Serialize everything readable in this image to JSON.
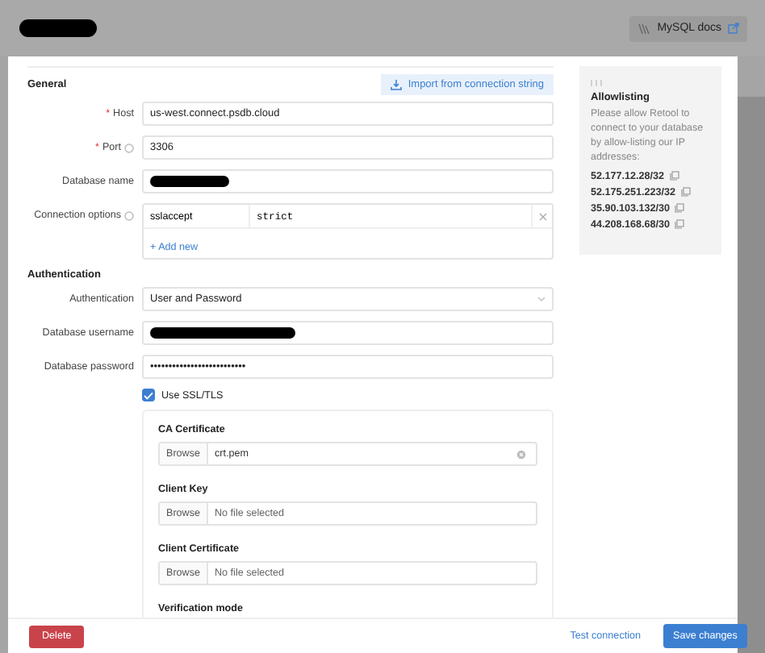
{
  "header": {
    "title_redacted": true,
    "docs_link": "MySQL docs"
  },
  "general": {
    "heading": "General",
    "import_button": "Import from connection string",
    "fields": [
      {
        "label": "Host",
        "marker": "*",
        "value": "us-west.connect.psdb.cloud"
      },
      {
        "label": "Port",
        "marker": "*",
        "info": true,
        "value": "3306"
      },
      {
        "label": "Database name",
        "redacted": true
      }
    ],
    "connection_options": {
      "label": "Connection options",
      "info": true,
      "rows": [
        {
          "key": "sslaccept",
          "value": "strict"
        }
      ],
      "add_button": "+ Add new"
    }
  },
  "authentication": {
    "heading": "Authentication",
    "method": {
      "label": "Authentication",
      "value": "User and Password"
    },
    "username": {
      "label": "Database username",
      "redacted": true
    },
    "password": {
      "label": "Database password",
      "value": "••••••••••••••••••••••••••"
    },
    "ssl": {
      "label": "Use SSL/TLS",
      "checked": true
    },
    "certificates": [
      {
        "label": "CA Certificate",
        "button": "Browse",
        "value": "crt.pem"
      },
      {
        "label": "Client Key",
        "button": "Browse",
        "placeholder": "No file selected"
      },
      {
        "label": "Client Certificate",
        "button": "Browse",
        "placeholder": "No file selected"
      }
    ],
    "verification_label": "Verification mode"
  },
  "allowlisting": {
    "title": "Allowlisting",
    "description": "Please allow Retool to connect to your database by allow-listing our IP addresses:",
    "addresses": [
      "52.177.12.28/32",
      "52.175.251.223/32",
      "35.90.103.132/30",
      "44.208.168.68/30"
    ]
  },
  "footer": {
    "delete": "Delete",
    "test": "Test connection",
    "save": "Save changes"
  }
}
